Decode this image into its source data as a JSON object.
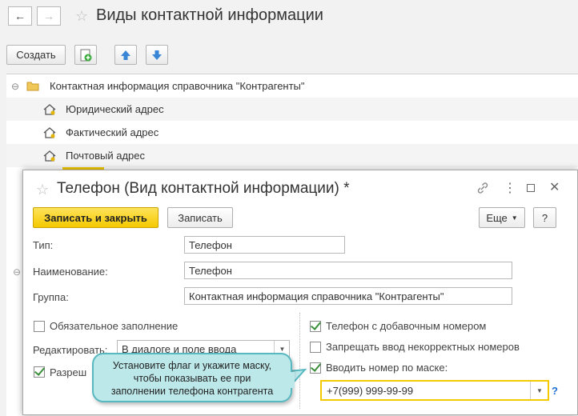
{
  "window": {
    "title": "Виды контактной информации"
  },
  "toolbar": {
    "create_label": "Создать"
  },
  "tree": {
    "root_label": "Контактная информация справочника \"Контрагенты\"",
    "items": [
      {
        "label": "Юридический адрес"
      },
      {
        "label": "Фактический адрес"
      },
      {
        "label": "Почтовый адрес"
      }
    ]
  },
  "dialog": {
    "title": "Телефон (Вид контактной информации) *",
    "save_close_label": "Записать и закрыть",
    "save_label": "Записать",
    "more_label": "Еще",
    "help_label": "?",
    "type": {
      "label": "Тип:",
      "value": "Телефон"
    },
    "name": {
      "label": "Наименование:",
      "value": "Телефон"
    },
    "group": {
      "label": "Группа:",
      "value": "Контактная информация справочника \"Контрагенты\""
    },
    "required": {
      "label": "Обязательное заполнение",
      "checked": false
    },
    "edit": {
      "label": "Редактировать:",
      "value": "В диалоге и поле ввода"
    },
    "allow": {
      "label": "Разреш",
      "checked": true
    },
    "ext_number": {
      "label": "Телефон с добавочным номером",
      "checked": true
    },
    "forbid_incorrect": {
      "label": "Запрещать ввод некорректных номеров",
      "checked": false
    },
    "mask": {
      "label": "Вводить номер по маске:",
      "checked": true,
      "value": "+7(999) 999-99-99",
      "help": "?"
    }
  },
  "callout": {
    "line1": "Установите флаг и укажите маску,",
    "line2": "чтобы показывать ее при",
    "line3": "заполнении телефона контрагента"
  },
  "colors": {
    "accent_yellow": "#f4c900",
    "callout_fill": "#bde8ea",
    "callout_border": "#58b8c0",
    "check_green": "#3a8f3a"
  }
}
